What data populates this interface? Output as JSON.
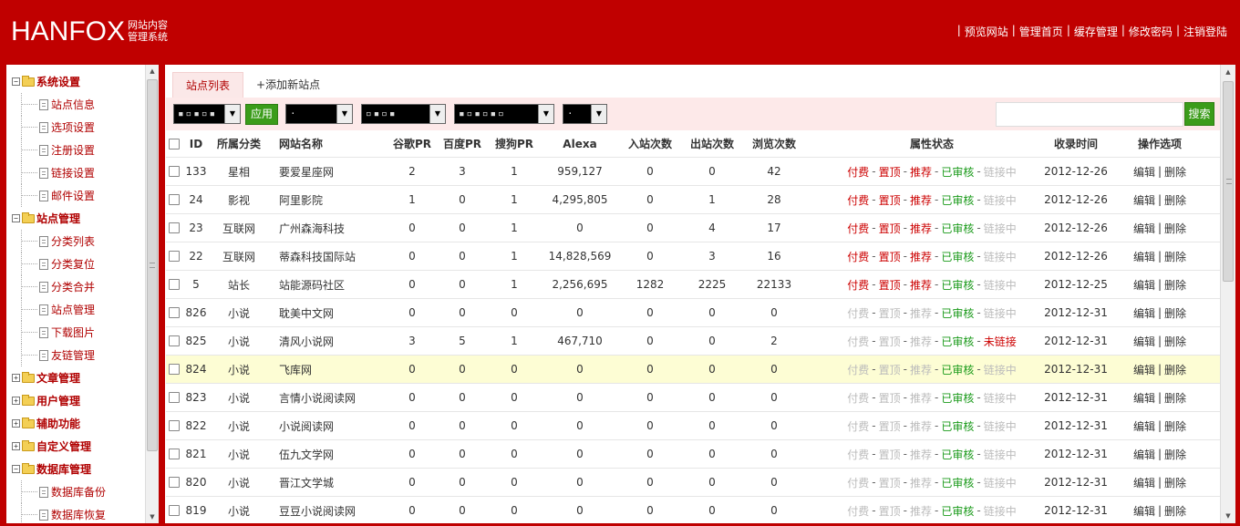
{
  "header": {
    "logo_main": "HANFOX",
    "logo_sub_1": "网站内容",
    "logo_sub_2": "管理系统",
    "nav": [
      "预览网站",
      "管理首页",
      "缓存管理",
      "修改密码",
      "注销登陆"
    ]
  },
  "sidebar": {
    "groups": [
      {
        "label": "系统设置",
        "expanded": true,
        "items": [
          "站点信息",
          "选项设置",
          "注册设置",
          "链接设置",
          "邮件设置"
        ]
      },
      {
        "label": "站点管理",
        "expanded": true,
        "items": [
          "分类列表",
          "分类复位",
          "分类合并",
          "站点管理",
          "下载图片",
          "友链管理"
        ]
      },
      {
        "label": "文章管理",
        "expanded": false,
        "items": []
      },
      {
        "label": "用户管理",
        "expanded": false,
        "items": []
      },
      {
        "label": "辅助功能",
        "expanded": false,
        "items": []
      },
      {
        "label": "自定义管理",
        "expanded": false,
        "items": []
      },
      {
        "label": "数据库管理",
        "expanded": true,
        "items": [
          "数据库备份",
          "数据库恢复"
        ]
      }
    ]
  },
  "main": {
    "tabs": [
      {
        "label": "站点列表",
        "active": true
      },
      {
        "label": "+添加新站点",
        "active": false
      }
    ],
    "toolbar": {
      "apply_label": "应用",
      "search_label": "搜索",
      "search_value": "",
      "selects": [
        "",
        "",
        "",
        "",
        ""
      ]
    },
    "columns": [
      "ID",
      "所属分类",
      "网站名称",
      "谷歌PR",
      "百度PR",
      "搜狗PR",
      "Alexa",
      "入站次数",
      "出站次数",
      "浏览次数",
      "属性状态",
      "收录时间",
      "操作选项"
    ],
    "attr_labels": [
      "付费",
      "置顶",
      "推荐",
      "已审核"
    ],
    "link_ok": "链接中",
    "link_bad": "未链接",
    "op_edit": "编辑",
    "op_delete": "删除",
    "rows": [
      {
        "id": "133",
        "cat": "星相",
        "name": "要爱星座网",
        "gpr": "2",
        "bpr": "3",
        "spr": "1",
        "alexa": "959,127",
        "inb": "0",
        "outb": "0",
        "views": "42",
        "paid": true,
        "top": true,
        "rec": true,
        "link": "ok",
        "date": "2012-12-26"
      },
      {
        "id": "24",
        "cat": "影视",
        "name": "阿里影院",
        "gpr": "1",
        "bpr": "0",
        "spr": "1",
        "alexa": "4,295,805",
        "inb": "0",
        "outb": "1",
        "views": "28",
        "paid": true,
        "top": true,
        "rec": true,
        "link": "ok",
        "date": "2012-12-26"
      },
      {
        "id": "23",
        "cat": "互联网",
        "name": "广州森海科技",
        "gpr": "0",
        "bpr": "0",
        "spr": "1",
        "alexa": "0",
        "inb": "0",
        "outb": "4",
        "views": "17",
        "paid": true,
        "top": true,
        "rec": true,
        "link": "ok",
        "date": "2012-12-26"
      },
      {
        "id": "22",
        "cat": "互联网",
        "name": "蒂森科技国际站",
        "gpr": "0",
        "bpr": "0",
        "spr": "1",
        "alexa": "14,828,569",
        "inb": "0",
        "outb": "3",
        "views": "16",
        "paid": true,
        "top": true,
        "rec": true,
        "link": "ok",
        "date": "2012-12-26"
      },
      {
        "id": "5",
        "cat": "站长",
        "name": "站能源码社区",
        "gpr": "0",
        "bpr": "0",
        "spr": "1",
        "alexa": "2,256,695",
        "inb": "1282",
        "outb": "2225",
        "views": "22133",
        "paid": true,
        "top": true,
        "rec": true,
        "link": "ok",
        "date": "2012-12-25"
      },
      {
        "id": "826",
        "cat": "小说",
        "name": "耽美中文网",
        "gpr": "0",
        "bpr": "0",
        "spr": "0",
        "alexa": "0",
        "inb": "0",
        "outb": "0",
        "views": "0",
        "paid": false,
        "top": false,
        "rec": false,
        "link": "ok",
        "date": "2012-12-31"
      },
      {
        "id": "825",
        "cat": "小说",
        "name": "清风小说网",
        "gpr": "3",
        "bpr": "5",
        "spr": "1",
        "alexa": "467,710",
        "inb": "0",
        "outb": "0",
        "views": "2",
        "paid": false,
        "top": false,
        "rec": false,
        "link": "bad",
        "date": "2012-12-31"
      },
      {
        "id": "824",
        "cat": "小说",
        "name": "飞库网",
        "gpr": "0",
        "bpr": "0",
        "spr": "0",
        "alexa": "0",
        "inb": "0",
        "outb": "0",
        "views": "0",
        "paid": false,
        "top": false,
        "rec": false,
        "link": "ok",
        "date": "2012-12-31",
        "highlight": true
      },
      {
        "id": "823",
        "cat": "小说",
        "name": "言情小说阅读网",
        "gpr": "0",
        "bpr": "0",
        "spr": "0",
        "alexa": "0",
        "inb": "0",
        "outb": "0",
        "views": "0",
        "paid": false,
        "top": false,
        "rec": false,
        "link": "ok",
        "date": "2012-12-31"
      },
      {
        "id": "822",
        "cat": "小说",
        "name": "小说阅读网",
        "gpr": "0",
        "bpr": "0",
        "spr": "0",
        "alexa": "0",
        "inb": "0",
        "outb": "0",
        "views": "0",
        "paid": false,
        "top": false,
        "rec": false,
        "link": "ok",
        "date": "2012-12-31"
      },
      {
        "id": "821",
        "cat": "小说",
        "name": "伍九文学网",
        "gpr": "0",
        "bpr": "0",
        "spr": "0",
        "alexa": "0",
        "inb": "0",
        "outb": "0",
        "views": "0",
        "paid": false,
        "top": false,
        "rec": false,
        "link": "ok",
        "date": "2012-12-31"
      },
      {
        "id": "820",
        "cat": "小说",
        "name": "晋江文学城",
        "gpr": "0",
        "bpr": "0",
        "spr": "0",
        "alexa": "0",
        "inb": "0",
        "outb": "0",
        "views": "0",
        "paid": false,
        "top": false,
        "rec": false,
        "link": "ok",
        "date": "2012-12-31"
      },
      {
        "id": "819",
        "cat": "小说",
        "name": "豆豆小说阅读网",
        "gpr": "0",
        "bpr": "0",
        "spr": "0",
        "alexa": "0",
        "inb": "0",
        "outb": "0",
        "views": "0",
        "paid": false,
        "top": false,
        "rec": false,
        "link": "ok",
        "date": "2012-12-31"
      }
    ]
  },
  "colors": {
    "brand": "#c00000",
    "on": "#cc0000",
    "off": "#bbbbbb",
    "ok": "#1a9a1a",
    "apply": "#3b9c1a"
  }
}
